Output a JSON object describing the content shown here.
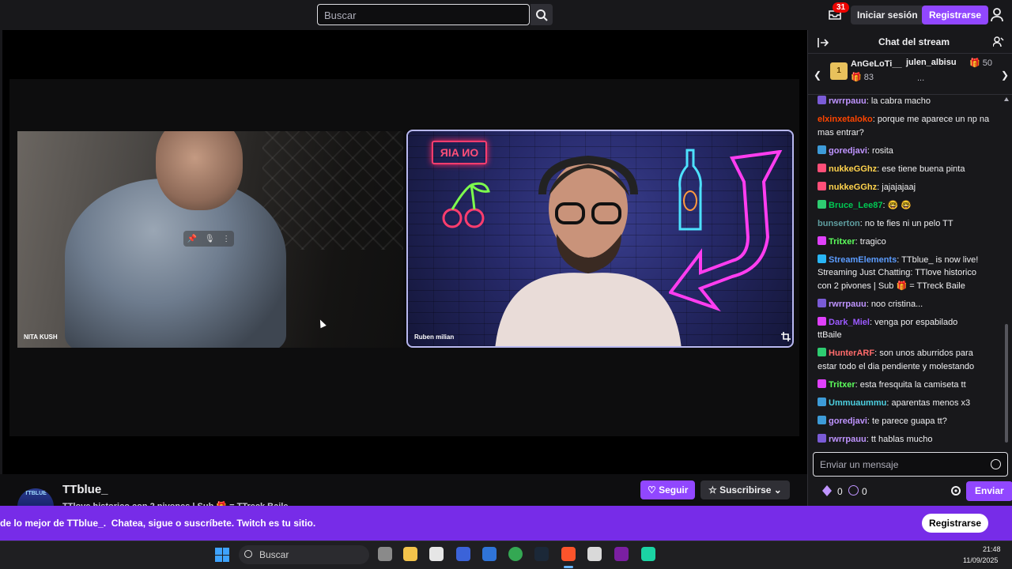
{
  "header": {
    "search_placeholder": "Buscar",
    "notification_count": "31",
    "login_label": "Iniciar sesión",
    "register_label": "Registrarse"
  },
  "player": {
    "guest_name": "NITA KUSH",
    "host_name": "Ruben milian",
    "on_air_sign": "ON AIR"
  },
  "channel": {
    "name": "TTblue_",
    "avatar_text": "TTBLUE",
    "title_partial": "TTlove historico con 2 pivones | Sub 🎁 = TTreck Baile",
    "follow_label": "Seguir",
    "subscribe_label": "Suscribirse"
  },
  "chat": {
    "title": "Chat del stream",
    "leaderboard": {
      "first_user": "AnGeLoTi__",
      "first_count": "83",
      "second_user": "julen_albisu",
      "second_count": "50",
      "more": "..."
    },
    "messages": [
      {
        "user": "rwrrpauu",
        "color": "#bf94ff",
        "badge_color": "#7a5bd6",
        "lines": [
          "la cabra macho"
        ]
      },
      {
        "user": "elxinxetaloko",
        "color": "#ff4500",
        "badge_color": "",
        "lines": [
          "porque me aparece un np na",
          "mas entrar?"
        ]
      },
      {
        "user": "goredjavi",
        "color": "#bf94ff",
        "badge_color": "#3d9bd8",
        "lines": [
          "rosita"
        ]
      },
      {
        "user": "nukkeGGhz",
        "color": "#ffd34d",
        "badge_color": "#ff4f78",
        "lines": [
          "ese tiene buena pinta"
        ]
      },
      {
        "user": "nukkeGGhz",
        "color": "#ffd34d",
        "badge_color": "#ff4f78",
        "lines": [
          "jajajajaaj"
        ]
      },
      {
        "user": "Bruce_Lee87",
        "color": "#00c853",
        "badge_color": "#2ecc71",
        "lines": [
          "🤓 🤓"
        ]
      },
      {
        "user": "bunserton",
        "color": "#5f9ea0",
        "badge_color": "",
        "lines": [
          "no te fies ni un pelo TT"
        ]
      },
      {
        "user": "Tritxer",
        "color": "#5cff5c",
        "badge_color": "#e040fb",
        "lines": [
          "tragico"
        ]
      },
      {
        "user": "StreamElements",
        "color": "#5b9cff",
        "badge_color": "#29b6f6",
        "lines": [
          "TTblue_ is now live!",
          "Streaming Just Chatting: TTlove historico",
          "con 2 pivones | Sub 🎁 = TTreck Baile"
        ]
      },
      {
        "user": "rwrrpauu",
        "color": "#bf94ff",
        "badge_color": "#7a5bd6",
        "lines": [
          "noo cristina..."
        ]
      },
      {
        "user": "Dark_Miel",
        "color": "#9b59ff",
        "badge_color": "#e040fb",
        "lines": [
          "venga por espabilado",
          "ttBaile"
        ]
      },
      {
        "user": "HunterARF",
        "color": "#ff6b6b",
        "badge_color": "#2ecc71",
        "lines": [
          "son unos aburridos para",
          "estar todo el dia pendiente y molestando"
        ]
      },
      {
        "user": "Tritxer",
        "color": "#5cff5c",
        "badge_color": "#e040fb",
        "lines": [
          "esta fresquita la camiseta tt"
        ]
      },
      {
        "user": "Ummuaummu",
        "color": "#4dd0e1",
        "badge_color": "#3d9bd8",
        "lines": [
          "aparentas menos x3"
        ]
      },
      {
        "user": "goredjavi",
        "color": "#bf94ff",
        "badge_color": "#3d9bd8",
        "lines": [
          "te parece guapa tt?"
        ]
      },
      {
        "user": "rwrrpauu",
        "color": "#bf94ff",
        "badge_color": "#7a5bd6",
        "lines": [
          "tt hablas mucho"
        ]
      }
    ],
    "input_placeholder": "Enviar un mensaje",
    "points_value": "0",
    "watch_value": "0",
    "send_label": "Enviar"
  },
  "banner": {
    "text_bold": "de lo mejor de TTblue_.",
    "text_rest": "Chatea, sigue o suscríbete. Twitch es tu sitio.",
    "button_label": "Registrarse"
  },
  "taskbar": {
    "search_label": "Buscar",
    "time": "21:48",
    "date": "11/09/2025"
  },
  "colors": {
    "brand": "#9147ff",
    "banner": "#772ce8",
    "background": "#0e0e10",
    "panel": "#18181b"
  }
}
